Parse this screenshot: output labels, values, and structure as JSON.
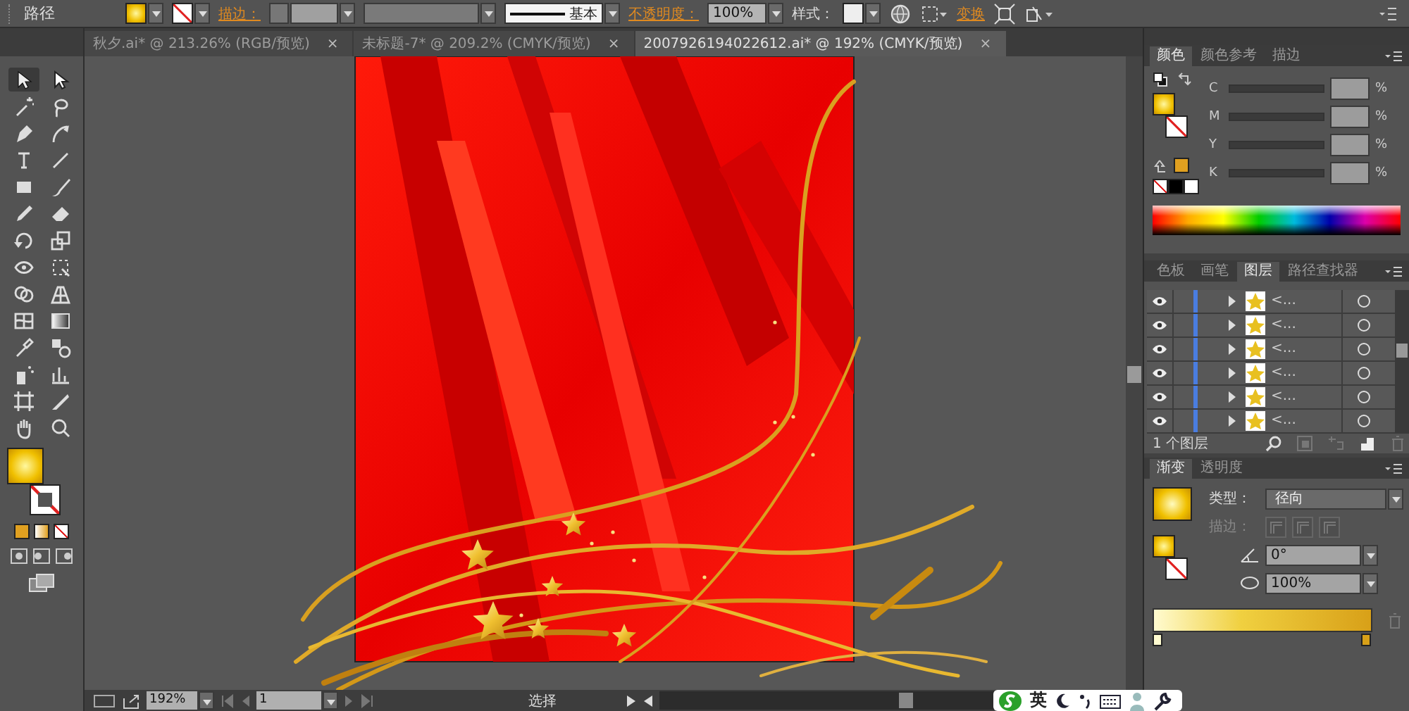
{
  "control_bar": {
    "object_label": "路径",
    "stroke_label": "描边：",
    "stroke_profile": "基本",
    "opacity_label": "不透明度：",
    "opacity_value": "100%",
    "style_label": "样式：",
    "transform_label": "变换"
  },
  "document_tabs": [
    {
      "title": "秋夕.ai* @ 213.26% (RGB/预览)",
      "close": "×",
      "selected": false
    },
    {
      "title": "未标题-7* @ 209.2% (CMYK/预览)",
      "close": "×",
      "selected": false
    },
    {
      "title": "2007926194022612.ai* @ 192% (CMYK/预览)",
      "close": "×",
      "selected": true
    }
  ],
  "tools": [
    {
      "kind": "selection",
      "selected": true
    },
    {
      "kind": "direct",
      "selected": false
    },
    {
      "kind": "wand",
      "selected": false
    },
    {
      "kind": "lasso",
      "selected": false
    },
    {
      "kind": "pen",
      "selected": false
    },
    {
      "kind": "curvature",
      "selected": false
    },
    {
      "kind": "type",
      "selected": false
    },
    {
      "kind": "line",
      "selected": false
    },
    {
      "kind": "rect",
      "selected": false
    },
    {
      "kind": "brush",
      "selected": false
    },
    {
      "kind": "pencil",
      "selected": false
    },
    {
      "kind": "eraser",
      "selected": false
    },
    {
      "kind": "rotate",
      "selected": false
    },
    {
      "kind": "scale",
      "selected": false
    },
    {
      "kind": "width",
      "selected": false
    },
    {
      "kind": "freetransform",
      "selected": false
    },
    {
      "kind": "shapebuilder",
      "selected": false
    },
    {
      "kind": "perspective",
      "selected": false
    },
    {
      "kind": "mesh",
      "selected": false
    },
    {
      "kind": "gradient",
      "selected": false
    },
    {
      "kind": "eyedropper",
      "selected": false
    },
    {
      "kind": "blend",
      "selected": false
    },
    {
      "kind": "symbol",
      "selected": false
    },
    {
      "kind": "graph",
      "selected": false
    },
    {
      "kind": "artboard",
      "selected": false
    },
    {
      "kind": "slice",
      "selected": false
    },
    {
      "kind": "hand",
      "selected": false
    },
    {
      "kind": "zoom",
      "selected": false
    }
  ],
  "color_panel": {
    "tabs": [
      {
        "label": "颜色",
        "selected": true
      },
      {
        "label": "颜色参考",
        "selected": false
      },
      {
        "label": "描边",
        "selected": false
      }
    ],
    "channels": [
      {
        "label": "C",
        "unit": "%"
      },
      {
        "label": "M",
        "unit": "%"
      },
      {
        "label": "Y",
        "unit": "%"
      },
      {
        "label": "K",
        "unit": "%"
      }
    ]
  },
  "layers_panel": {
    "tabs": [
      {
        "label": "色板",
        "selected": false
      },
      {
        "label": "画笔",
        "selected": false
      },
      {
        "label": "图层",
        "selected": true
      },
      {
        "label": "路径查找器",
        "selected": false
      }
    ],
    "rows": [
      {
        "name": "<...",
        "visible": true,
        "expanded": false
      },
      {
        "name": "<...",
        "visible": true,
        "expanded": false
      },
      {
        "name": "<...",
        "visible": true,
        "expanded": false
      },
      {
        "name": "<...",
        "visible": true,
        "expanded": false
      },
      {
        "name": "<...",
        "visible": true,
        "expanded": false
      },
      {
        "name": "<...",
        "visible": true,
        "expanded": false
      }
    ],
    "footer": "1 个图层"
  },
  "gradient_panel": {
    "tabs": [
      {
        "label": "渐变",
        "selected": true
      },
      {
        "label": "透明度",
        "selected": false
      }
    ],
    "type_label": "类型：",
    "type_value": "径向",
    "stroke_label": "描边：",
    "stroke_disabled": true,
    "angle": "0°",
    "aspect": "100%"
  },
  "status_bar": {
    "zoom": "192%",
    "artboard": "1",
    "tool": "选择"
  },
  "ime_bar": {
    "language": "英"
  }
}
